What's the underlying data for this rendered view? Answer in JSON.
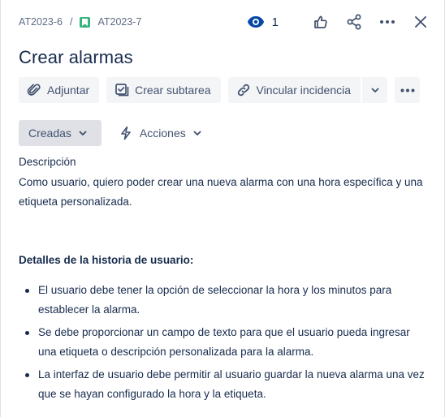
{
  "breadcrumb": {
    "parent": "AT2023-6",
    "separator": "/",
    "current": "AT2023-7"
  },
  "header": {
    "watchers_count": "1"
  },
  "issue": {
    "title": "Crear alarmas"
  },
  "toolbar": {
    "attach_label": "Adjuntar",
    "subtask_label": "Crear subtarea",
    "link_label": "Vincular incidencia"
  },
  "status": {
    "current": "Creadas",
    "actions_label": "Acciones"
  },
  "description": {
    "heading": "Descripción",
    "intro": "Como usuario, quiero poder crear una nueva alarma con una hora específica y una etiqueta personalizada.",
    "details_heading": "Detalles de la historia de usuario:",
    "bullets": [
      "El usuario debe tener la opción de seleccionar la hora y los minutos para establecer la alarma.",
      "Se debe proporcionar un campo de texto para que el usuario pueda ingresar una etiqueta o descripción personalizada para la alarma.",
      "La interfaz de usuario debe permitir al usuario guardar la nueva alarma una vez que se hayan configurado la hora y la etiqueta."
    ]
  },
  "colors": {
    "text": "#172b4d",
    "muted": "#42526e",
    "story_green": "#36b37e",
    "watch_blue": "#0747a6",
    "button_bg": "#f4f5f7",
    "status_bg": "#dfe1e6"
  },
  "icons": [
    "story-icon",
    "eye-icon",
    "thumbs-up-icon",
    "share-icon",
    "more-icon",
    "close-icon",
    "paperclip-icon",
    "subtask-icon",
    "link-icon",
    "chevron-down-icon",
    "lightning-icon"
  ]
}
